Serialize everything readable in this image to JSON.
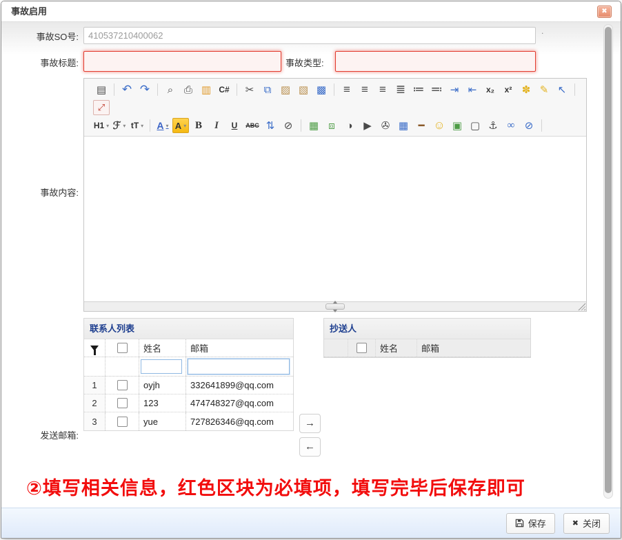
{
  "dialog": {
    "title": "事故启用",
    "close_icon": "✖"
  },
  "form": {
    "so_label": "事故SO号:",
    "so_value": "410537210400062",
    "so_suffix": ".",
    "title_label": "事故标题:",
    "type_label": "事故类型:",
    "content_label": "事故内容:",
    "send_label": "发送邮箱:"
  },
  "editor": {
    "toolbar_row1": [
      {
        "name": "source-code-icon",
        "glyph": "▤",
        "cls": "dark"
      },
      {
        "name": "toolbar-separator",
        "cls": "sep",
        "interactable": false
      },
      {
        "name": "undo-icon",
        "glyph": "↶",
        "cls": "blue big"
      },
      {
        "name": "redo-icon",
        "glyph": "↷",
        "cls": "blue big"
      },
      {
        "name": "toolbar-separator",
        "cls": "sep",
        "interactable": false
      },
      {
        "name": "preview-icon",
        "glyph": "⌕",
        "cls": "dark"
      },
      {
        "name": "print-icon",
        "glyph": "⎙",
        "cls": "dark"
      },
      {
        "name": "template-icon",
        "glyph": "▥",
        "cls": "orange"
      },
      {
        "name": "code-icon",
        "glyph": "C#",
        "cls": "txt"
      },
      {
        "name": "toolbar-separator",
        "cls": "sep",
        "interactable": false
      },
      {
        "name": "cut-icon",
        "glyph": "✂",
        "cls": "dark"
      },
      {
        "name": "copy-icon",
        "glyph": "⧉",
        "cls": "blue"
      },
      {
        "name": "paste-icon",
        "glyph": "▨",
        "cls": "tan"
      },
      {
        "name": "paste-text-icon",
        "glyph": "▧",
        "cls": "tan"
      },
      {
        "name": "paste-word-icon",
        "glyph": "▩",
        "cls": "blue"
      },
      {
        "name": "toolbar-separator",
        "cls": "sep",
        "interactable": false
      },
      {
        "name": "align-left-icon",
        "glyph": "≡",
        "cls": "dark big"
      },
      {
        "name": "align-center-icon",
        "glyph": "≡",
        "cls": "dark big"
      },
      {
        "name": "align-right-icon",
        "glyph": "≡",
        "cls": "dark big"
      },
      {
        "name": "justify-icon",
        "glyph": "≣",
        "cls": "dark big"
      },
      {
        "name": "ordered-list-icon",
        "glyph": "≔",
        "cls": "dark big"
      },
      {
        "name": "unordered-list-icon",
        "glyph": "≕",
        "cls": "dark big"
      },
      {
        "name": "indent-icon",
        "glyph": "⇥",
        "cls": "blue"
      },
      {
        "name": "outdent-icon",
        "glyph": "⇤",
        "cls": "blue"
      },
      {
        "name": "subscript-icon",
        "glyph": "x₂",
        "cls": "txt"
      },
      {
        "name": "superscript-icon",
        "glyph": "x²",
        "cls": "txt"
      },
      {
        "name": "clean-format-icon",
        "glyph": "✽",
        "cls": "gold"
      },
      {
        "name": "quick-format-icon",
        "glyph": "✎",
        "cls": "gold"
      },
      {
        "name": "select-all-icon",
        "glyph": "↖",
        "cls": "blue"
      },
      {
        "name": "toolbar-separator",
        "cls": "sep",
        "interactable": false
      }
    ],
    "toolbar_row1_wrap": [
      {
        "name": "fullscreen-icon",
        "glyph": "⤢",
        "cls": "red boxed"
      }
    ],
    "toolbar_row2": [
      {
        "name": "heading-select",
        "glyph": "H1",
        "cls": "txt drop"
      },
      {
        "name": "font-family-select",
        "glyph": "ℱ",
        "cls": "serif drop"
      },
      {
        "name": "font-size-select",
        "glyph": "tT",
        "cls": "txt drop"
      },
      {
        "name": "toolbar-separator",
        "cls": "sep",
        "interactable": false
      },
      {
        "name": "font-color-select",
        "glyph": "A",
        "cls": "fontcolor drop"
      },
      {
        "name": "highlight-color-select",
        "glyph": "A",
        "cls": "hilite drop"
      },
      {
        "name": "bold-icon",
        "glyph": "B",
        "cls": "txt b"
      },
      {
        "name": "italic-icon",
        "glyph": "I",
        "cls": "serif i"
      },
      {
        "name": "underline-icon",
        "glyph": "U",
        "cls": "txt u"
      },
      {
        "name": "strikethrough-icon",
        "glyph": "ABC",
        "cls": "txt strike"
      },
      {
        "name": "line-height-icon",
        "glyph": "⇅",
        "cls": "blue"
      },
      {
        "name": "remove-format-icon",
        "glyph": "⊘",
        "cls": "dark"
      },
      {
        "name": "toolbar-separator",
        "cls": "sep",
        "interactable": false
      },
      {
        "name": "insert-image-icon",
        "glyph": "▦",
        "cls": "green"
      },
      {
        "name": "insert-images-icon",
        "glyph": "⧈",
        "cls": "green"
      },
      {
        "name": "flash-icon",
        "glyph": "◑",
        "cls": "dark"
      },
      {
        "name": "video-icon",
        "glyph": "▶",
        "cls": "dark"
      },
      {
        "name": "attachment-icon",
        "glyph": "✇",
        "cls": "dark"
      },
      {
        "name": "table-icon",
        "glyph": "▦",
        "cls": "blue"
      },
      {
        "name": "hr-icon",
        "glyph": "━",
        "cls": "brown"
      },
      {
        "name": "emoticon-icon",
        "glyph": "☺",
        "cls": "gold big"
      },
      {
        "name": "media-icon",
        "glyph": "▣",
        "cls": "green"
      },
      {
        "name": "save-draft-icon",
        "glyph": "▢",
        "cls": "dark"
      },
      {
        "name": "anchor-icon",
        "glyph": "⚓",
        "cls": "dark"
      },
      {
        "name": "link-icon",
        "glyph": "∞",
        "cls": "blue b"
      },
      {
        "name": "unlink-icon",
        "glyph": "⊘",
        "cls": "blue"
      },
      {
        "name": "toolbar-separator",
        "cls": "sep",
        "interactable": false
      }
    ]
  },
  "contacts": {
    "title": "联系人列表",
    "name_col": "姓名",
    "email_col": "邮箱",
    "rows": [
      {
        "num": "1",
        "name": "oyjh",
        "email": "332641899@qq.com"
      },
      {
        "num": "2",
        "name": "123",
        "email": "474748327@qq.com"
      },
      {
        "num": "3",
        "name": "yue",
        "email": "727826346@qq.com"
      }
    ]
  },
  "cc": {
    "title": "抄送人",
    "name_col": "姓名",
    "email_col": "邮箱"
  },
  "transfer": {
    "to_right": "→",
    "to_left": "←"
  },
  "annotation": "②填写相关信息，红色区块为必填项，填写完毕后保存即可",
  "footer": {
    "save_label": "保存",
    "close_label": "关闭",
    "close_icon": "✖"
  },
  "colors": {
    "required_border": "#e23b2e",
    "required_bg": "#fdf3f2",
    "footer_bg": "#dfeafa",
    "close_button": "#e78a6a",
    "panel_title": "#1d3e8f",
    "annotation_red": "#f20d0d"
  }
}
